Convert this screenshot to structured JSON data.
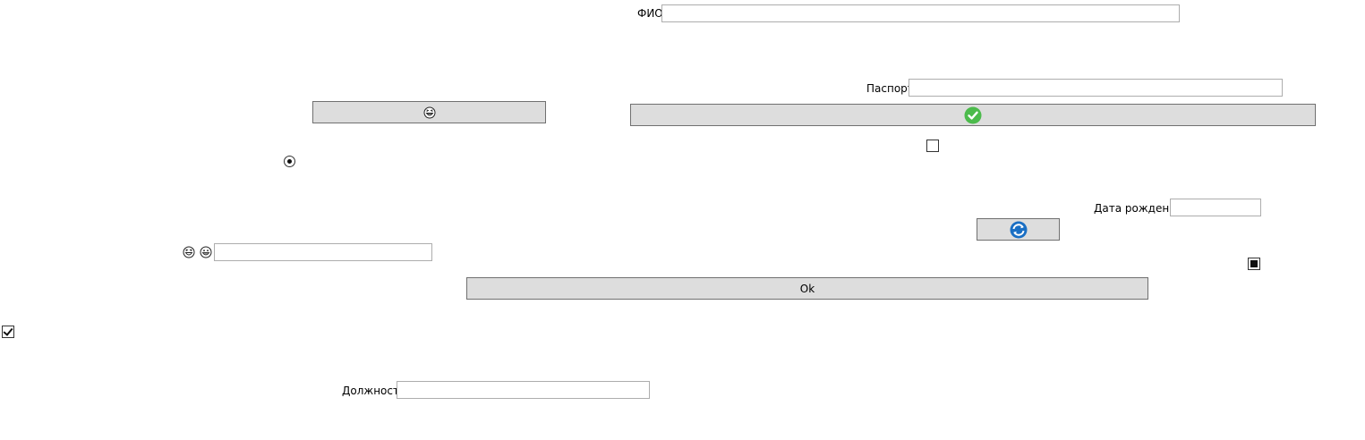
{
  "form": {
    "fio_label": "ФИО",
    "fio_value": "",
    "passport_label": "Паспорт",
    "passport_value": "",
    "birthdate_label": "Дата рождения",
    "birthdate_value": "",
    "position_label": "Должность",
    "position_value": "",
    "emoji_field_value": ""
  },
  "buttons": {
    "ok_label": "Ok",
    "emoji_button_icon": "laughing-face-icon",
    "check_button_icon": "green-checkmark-icon",
    "refresh_button_icon": "blue-refresh-icon"
  },
  "toggles": {
    "radio_selected": true,
    "checkbox_top_checked": false,
    "checkbox_right_state": "indeterminate",
    "checkbox_left_checked": true
  },
  "colors": {
    "button_bg": "#dddddd",
    "button_border": "#707070",
    "field_border": "#adadad",
    "check_green": "#4cbb4c",
    "refresh_blue": "#1a6fc4"
  }
}
